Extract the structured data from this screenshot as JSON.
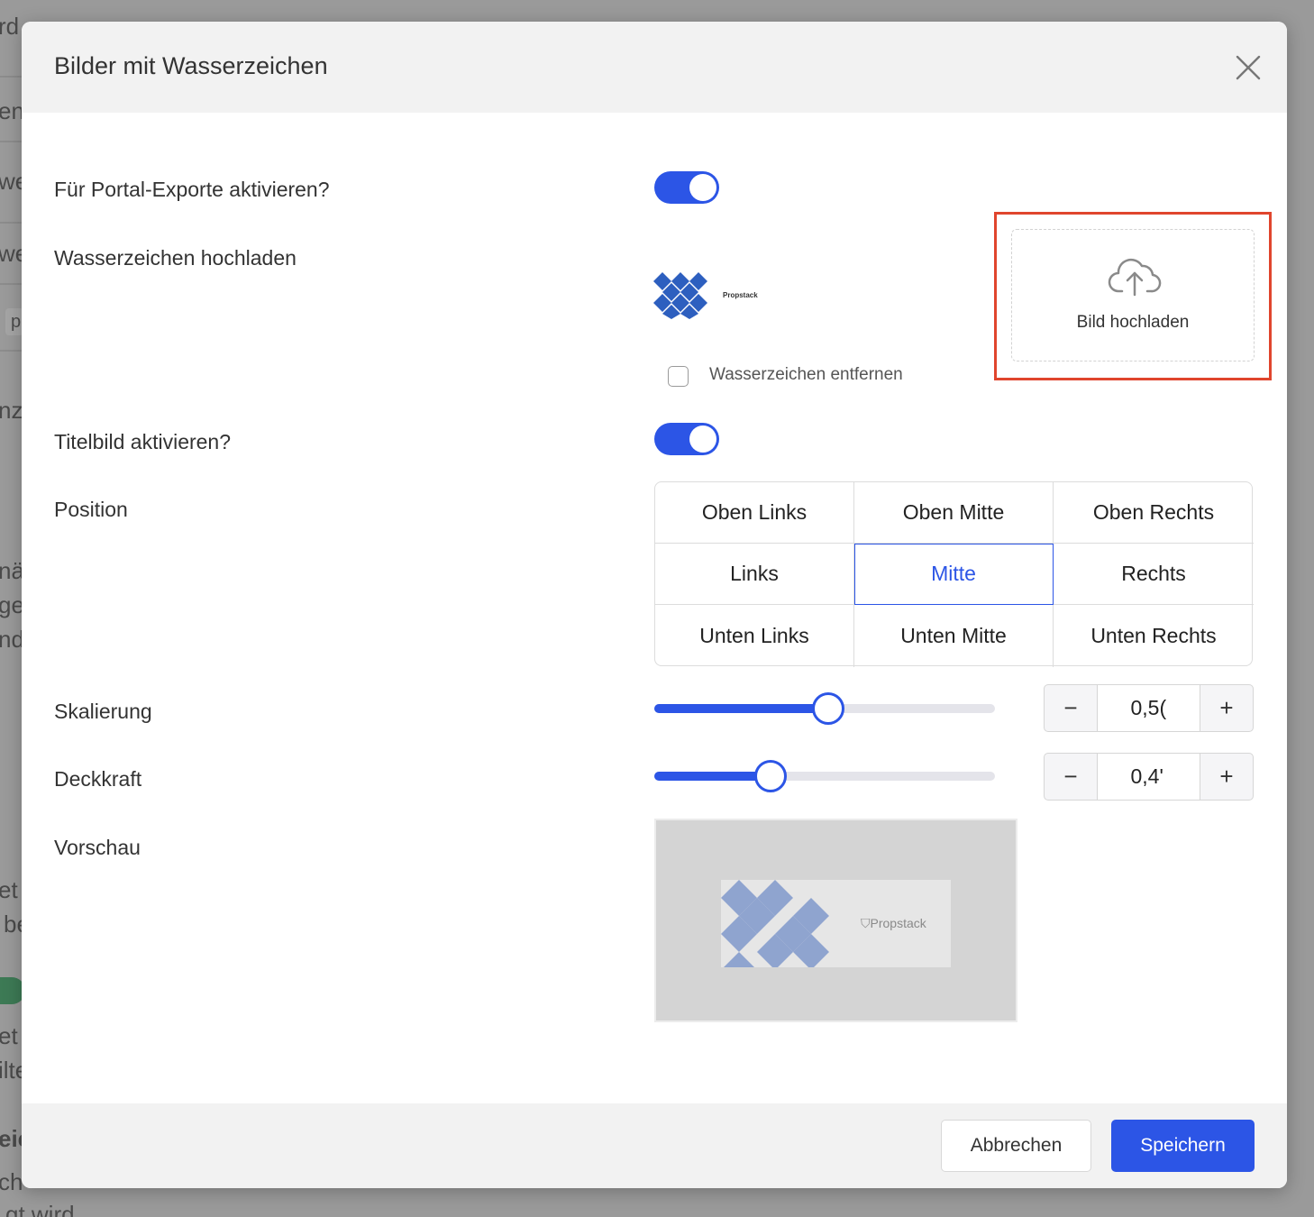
{
  "background_page": {
    "fragments": [
      "rd",
      "en",
      "we",
      "we",
      "p",
      "nzu",
      "näl",
      "ge",
      "nd",
      "et",
      "be",
      "et",
      "ilte",
      "eic",
      "ch",
      "gt wird"
    ]
  },
  "modal": {
    "title": "Bilder mit Wasserzeichen",
    "close_icon": "close-icon",
    "fields": {
      "portal_export_label": "Für Portal-Exporte aktivieren?",
      "portal_export_enabled": true,
      "upload_label": "Wasserzeichen hochladen",
      "logo_brand": "Propstack",
      "remove_watermark_label": "Wasserzeichen entfernen",
      "remove_watermark_checked": false,
      "upload_button_label": "Bild hochladen",
      "upload_icon": "cloud-upload-icon",
      "title_image_label": "Titelbild aktivieren?",
      "title_image_enabled": true,
      "position_label": "Position",
      "positions": [
        "Oben Links",
        "Oben Mitte",
        "Oben Rechts",
        "Links",
        "Mitte",
        "Rechts",
        "Unten Links",
        "Unten Mitte",
        "Unten Rechts"
      ],
      "selected_position": "Mitte",
      "scale_label": "Skalierung",
      "scale_value_display": "0,5(",
      "scale_slider_fraction": 0.51,
      "opacity_label": "Deckkraft",
      "opacity_value_display": "0,4'",
      "opacity_slider_fraction": 0.34,
      "preview_label": "Vorschau",
      "minus_symbol": "−",
      "plus_symbol": "+"
    },
    "footer": {
      "cancel_label": "Abbrechen",
      "save_label": "Speichern"
    },
    "colors": {
      "accent": "#2c55e6",
      "highlight": "#e0452d"
    }
  }
}
